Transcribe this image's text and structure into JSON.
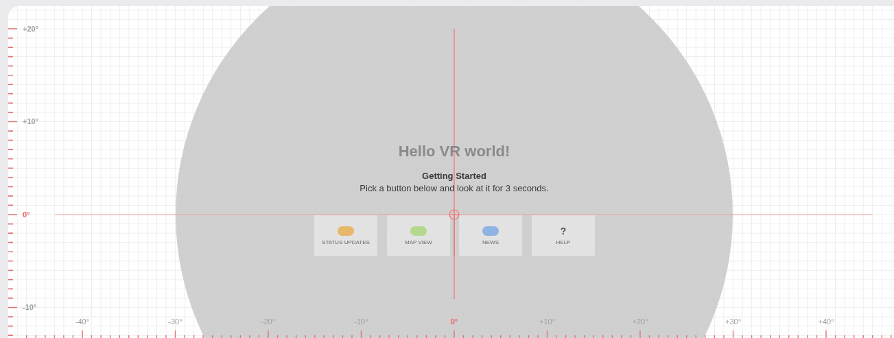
{
  "title": "Hello VR world!",
  "heading": "Getting Started",
  "instructions": "Pick a button below and look at it for 3 seconds.",
  "buttons": [
    {
      "label": "STATUS UPDATES",
      "kind": "pill",
      "color": "#e8b86a"
    },
    {
      "label": "MAP VIEW",
      "kind": "pill",
      "color": "#b4d98c"
    },
    {
      "label": "NEWS",
      "kind": "pill",
      "color": "#8fb3e3"
    },
    {
      "label": "HELP",
      "kind": "glyph",
      "glyph": "?"
    }
  ],
  "vertical_axis": [
    {
      "label": "+20°",
      "origin": false
    },
    {
      "label": "+10°",
      "origin": false
    },
    {
      "label": "0°",
      "origin": true
    },
    {
      "label": "-10°",
      "origin": false
    }
  ],
  "horizontal_axis": [
    {
      "label": "-40°",
      "origin": false
    },
    {
      "label": "-30°",
      "origin": false
    },
    {
      "label": "-20°",
      "origin": false
    },
    {
      "label": "-10°",
      "origin": false
    },
    {
      "label": "0°",
      "origin": true
    },
    {
      "label": "+10°",
      "origin": false
    },
    {
      "label": "+20°",
      "origin": false
    },
    {
      "label": "+30°",
      "origin": false
    },
    {
      "label": "+40°",
      "origin": false
    }
  ]
}
